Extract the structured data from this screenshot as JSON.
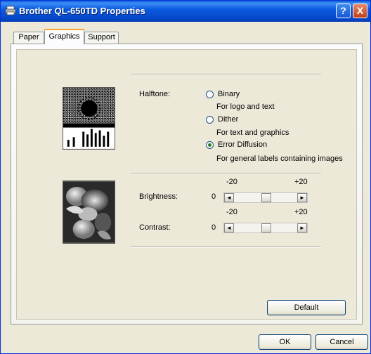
{
  "window": {
    "title": "Brother QL-650TD Properties",
    "help_label": "?",
    "close_label": "X"
  },
  "tabs": [
    {
      "label": "Paper",
      "active": false
    },
    {
      "label": "Graphics",
      "active": true
    },
    {
      "label": "Support",
      "active": false
    }
  ],
  "halftone": {
    "label": "Halftone:",
    "options": [
      {
        "label": "Binary",
        "description": "For logo and text",
        "selected": false
      },
      {
        "label": "Dither",
        "description": "For text and graphics",
        "selected": false
      },
      {
        "label": "Error Diffusion",
        "description": "For general labels containing images",
        "selected": true
      }
    ]
  },
  "brightness": {
    "label": "Brightness:",
    "min_label": "-20",
    "max_label": "+20",
    "value": "0",
    "left_arrow": "◄",
    "right_arrow": "►"
  },
  "contrast": {
    "label": "Contrast:",
    "min_label": "-20",
    "max_label": "+20",
    "value": "0",
    "left_arrow": "◄",
    "right_arrow": "►"
  },
  "buttons": {
    "default_label": "Default",
    "ok_label": "OK",
    "cancel_label": "Cancel"
  },
  "colors": {
    "titlebar": "#0a5fdc",
    "dialog_bg": "#ece9d8",
    "tab_accent": "#f7a330",
    "close_button": "#c4401a"
  }
}
